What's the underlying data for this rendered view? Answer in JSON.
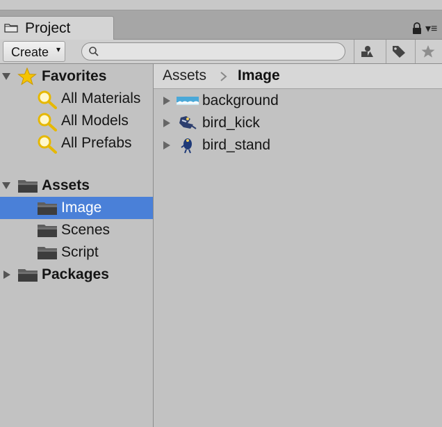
{
  "window": {
    "tab_title": "Project",
    "menu_glyph": "▾≡"
  },
  "toolbar": {
    "create_label": "Create",
    "create_arrow": "▾",
    "search_value": "",
    "search_placeholder": ""
  },
  "sidebar": {
    "favorites": {
      "label": "Favorites",
      "items": [
        {
          "label": "All Materials"
        },
        {
          "label": "All Models"
        },
        {
          "label": "All Prefabs"
        }
      ]
    },
    "assets": {
      "label": "Assets",
      "children": [
        {
          "label": "Image",
          "selected": true
        },
        {
          "label": "Scenes",
          "selected": false
        },
        {
          "label": "Script",
          "selected": false
        }
      ]
    },
    "packages": {
      "label": "Packages"
    }
  },
  "breadcrumb": {
    "root": "Assets",
    "current": "Image"
  },
  "assets_list": [
    {
      "name": "background",
      "icon": "sky-sprite-icon"
    },
    {
      "name": "bird_kick",
      "icon": "bird-sprite-icon"
    },
    {
      "name": "bird_stand",
      "icon": "bird-sprite-icon"
    }
  ],
  "colors": {
    "selection": "#4a80d8",
    "panel": "#c2c2c2",
    "star": "#f5c400"
  }
}
